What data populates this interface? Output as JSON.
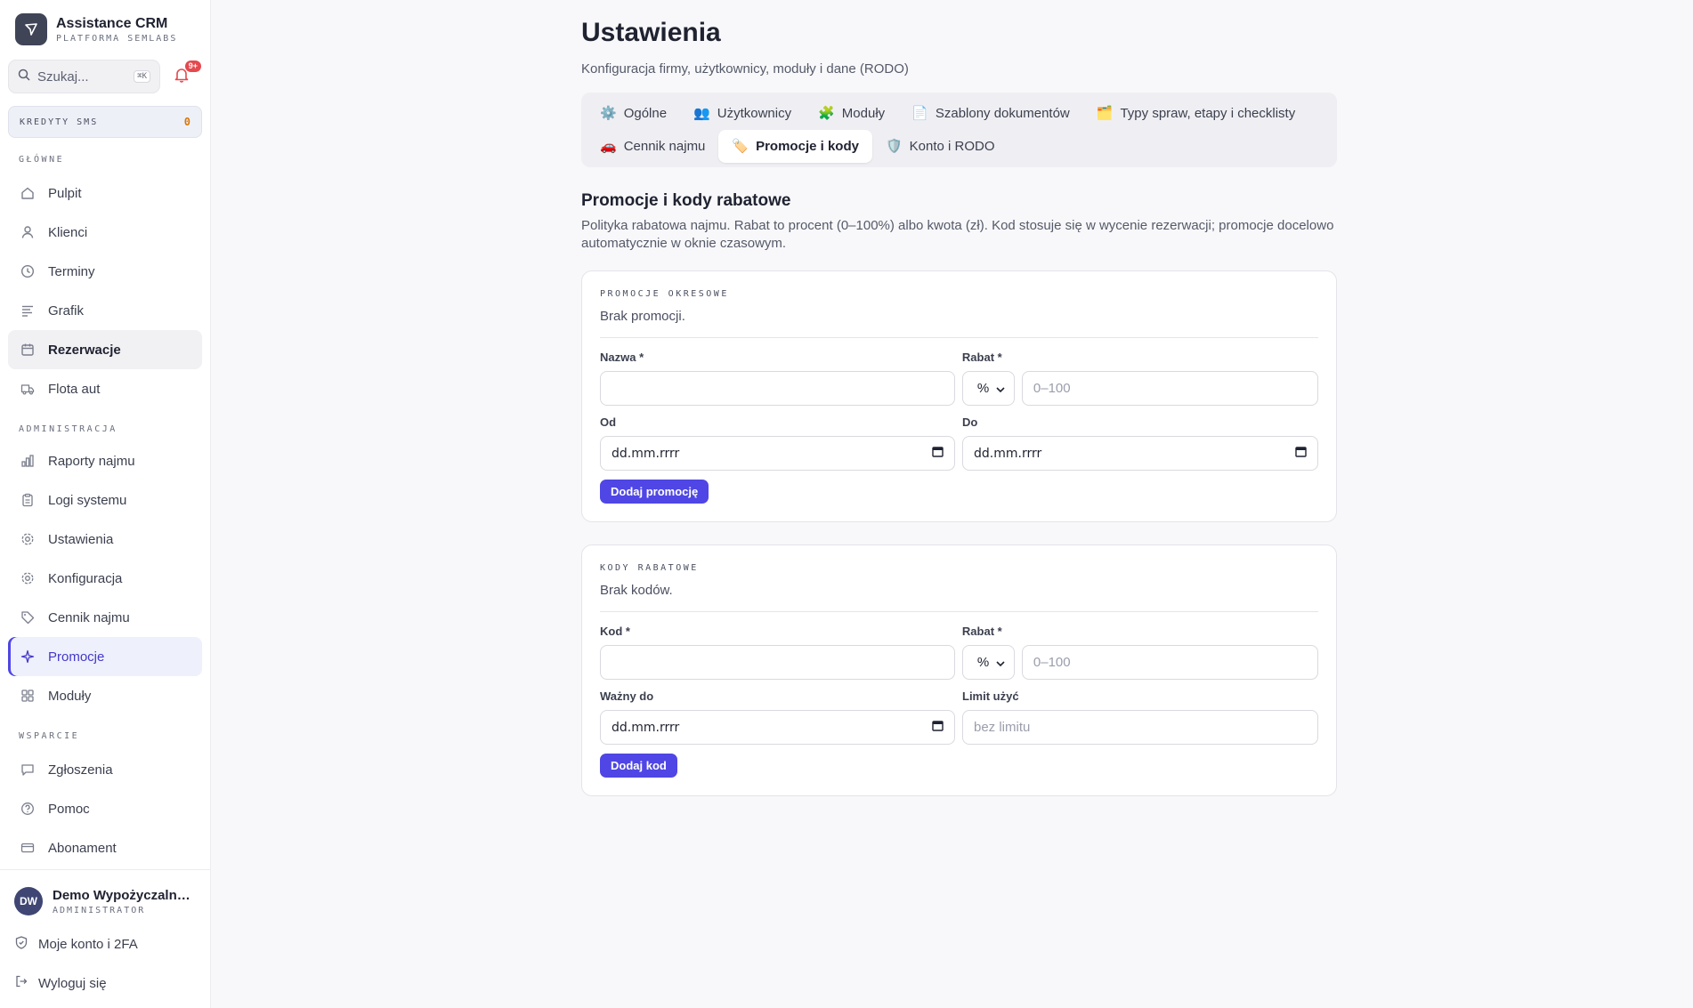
{
  "brand": {
    "name": "Assistance CRM",
    "subtitle": "PLATFORMA SEMLABS"
  },
  "search": {
    "placeholder": "Szukaj...",
    "shortcut": "⌘K"
  },
  "notifications": {
    "badge": "9+"
  },
  "credits": {
    "label": "KREDYTY SMS",
    "value": "0"
  },
  "nav": {
    "main_label": "GŁÓWNE",
    "main": [
      {
        "label": "Pulpit",
        "icon": "home-icon"
      },
      {
        "label": "Klienci",
        "icon": "user-icon"
      },
      {
        "label": "Terminy",
        "icon": "clock-icon"
      },
      {
        "label": "Grafik",
        "icon": "lines-icon"
      },
      {
        "label": "Rezerwacje",
        "icon": "calendar-icon"
      },
      {
        "label": "Flota aut",
        "icon": "truck-icon"
      }
    ],
    "admin_label": "ADMINISTRACJA",
    "admin": [
      {
        "label": "Raporty najmu",
        "icon": "bar-chart-icon"
      },
      {
        "label": "Logi systemu",
        "icon": "clipboard-icon"
      },
      {
        "label": "Ustawienia",
        "icon": "gear-icon"
      },
      {
        "label": "Konfiguracja",
        "icon": "gear-icon"
      },
      {
        "label": "Cennik najmu",
        "icon": "tag-icon"
      },
      {
        "label": "Promocje",
        "icon": "sparkle-icon"
      },
      {
        "label": "Moduły",
        "icon": "grid-icon"
      }
    ],
    "support_label": "WSPARCIE",
    "support": [
      {
        "label": "Zgłoszenia",
        "icon": "message-icon"
      },
      {
        "label": "Pomoc",
        "icon": "help-icon"
      },
      {
        "label": "Abonament",
        "icon": "card-icon"
      }
    ]
  },
  "user": {
    "initials": "DW",
    "name": "Demo Wypożyczalni...",
    "role": "ADMINISTRATOR"
  },
  "footer_links": {
    "account": "Moje konto i 2FA",
    "logout": "Wyloguj się"
  },
  "page": {
    "title": "Ustawienia",
    "subtitle": "Konfiguracja firmy, użytkownicy, moduły i dane (RODO)"
  },
  "tabs": [
    {
      "icon": "⚙️",
      "label": "Ogólne"
    },
    {
      "icon": "👥",
      "label": "Użytkownicy"
    },
    {
      "icon": "🧩",
      "label": "Moduły"
    },
    {
      "icon": "📄",
      "label": "Szablony dokumentów"
    },
    {
      "icon": "🗂️",
      "label": "Typy spraw, etapy i checklisty"
    },
    {
      "icon": "🚗",
      "label": "Cennik najmu"
    },
    {
      "icon": "🏷️",
      "label": "Promocje i kody"
    },
    {
      "icon": "🛡️",
      "label": "Konto i RODO"
    }
  ],
  "section": {
    "title": "Promocje i kody rabatowe",
    "description": "Polityka rabatowa najmu. Rabat to procent (0–100%) albo kwota (zł). Kod stosuje się w wycenie rezerwacji; promocje docelowo automatycznie w oknie czasowym."
  },
  "promotions": {
    "label": "PROMOCJE OKRESOWE",
    "empty": "Brak promocji.",
    "name_label": "Nazwa *",
    "discount_label": "Rabat *",
    "discount_type": "%",
    "discount_placeholder": "0–100",
    "from_label": "Od",
    "to_label": "Do",
    "date_placeholder": "dd.mm.rrrr",
    "button": "Dodaj promocję"
  },
  "codes": {
    "label": "KODY RABATOWE",
    "empty": "Brak kodów.",
    "code_label": "Kod *",
    "discount_label": "Rabat *",
    "discount_type": "%",
    "discount_placeholder": "0–100",
    "valid_label": "Ważny do",
    "limit_label": "Limit użyć",
    "date_placeholder": "dd.mm.rrrr",
    "limit_placeholder": "bez limitu",
    "button": "Dodaj kod"
  },
  "colors": {
    "accent": "#4f46e5",
    "credits": "#d97706",
    "badge": "#e5484d"
  }
}
